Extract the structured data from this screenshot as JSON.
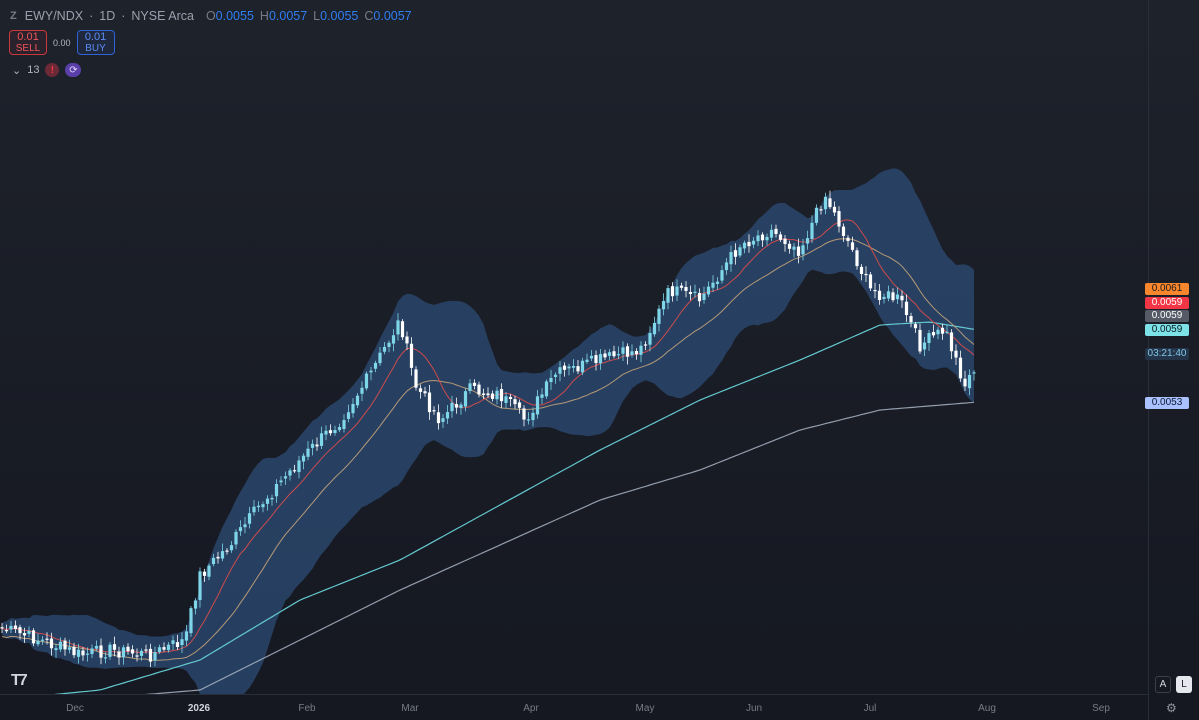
{
  "header": {
    "logo": "Z",
    "symbol": "EWY/NDX",
    "interval": "1D",
    "exchange": "NYSE Arca",
    "ohlc": [
      {
        "k": "O",
        "v": "0.0055"
      },
      {
        "k": "H",
        "v": "0.0057"
      },
      {
        "k": "L",
        "v": "0.0055"
      },
      {
        "k": "C",
        "v": "0.0057"
      }
    ]
  },
  "trade": {
    "sell_amount": "0.01",
    "sell_label": "SELL",
    "spread": "0.00",
    "buy_amount": "0.01",
    "buy_label": "BUY"
  },
  "indicators": {
    "count": "13",
    "warn": "!",
    "sync": "⟳"
  },
  "price_labels": [
    {
      "text": "0.0061",
      "bg": "#f7862d",
      "fg": "#1b1b1b"
    },
    {
      "text": "0.0059",
      "bg": "#f23645",
      "fg": "#ffffff"
    },
    {
      "text": "0.0059",
      "bg": "#555a66",
      "fg": "#ffffff"
    },
    {
      "text": "0.0059",
      "bg": "#7de2e8",
      "fg": "#0b1a1d"
    },
    {
      "text": "03:21:40",
      "bg": "#243449",
      "fg": "#7fc6e8"
    },
    {
      "text": "0.0053",
      "bg": "#a9c1ff",
      "fg": "#0d1730"
    }
  ],
  "x_axis": [
    "Dec",
    "2026",
    "Feb",
    "Mar",
    "Apr",
    "May",
    "Jun",
    "Jul",
    "Aug",
    "Sep"
  ],
  "scale_buttons": {
    "auto": "A",
    "log": "L"
  },
  "colors": {
    "band_fill": "#2b4a72",
    "up": "#7fd6e8",
    "down": "#ffffff",
    "ma_fast": "#e04b4b",
    "ma_mid": "#c7a37a",
    "ma_slow": "#64c8cf",
    "ma_long": "#a9b4c4"
  },
  "chart_data": {
    "type": "candlestick",
    "x_axis_labels": [
      "Dec",
      "2026",
      "Feb",
      "Mar",
      "Apr",
      "May",
      "Jun",
      "Jul",
      "Aug",
      "Sep"
    ],
    "y_unit": "ratio",
    "ohlc_close_sample": [
      0.0041,
      0.004,
      0.0039,
      0.0039,
      0.004,
      0.0044,
      0.0047,
      0.005,
      0.0052,
      0.0055,
      0.0053,
      0.0053,
      0.0054,
      0.0053,
      0.0055,
      0.0057,
      0.0059,
      0.0061,
      0.0061,
      0.0062,
      0.006,
      0.0059,
      0.0056,
      0.0055,
      0.0057
    ],
    "last_close": 0.0057,
    "open": 0.0055,
    "high": 0.0057,
    "low": 0.0055,
    "close": 0.0057,
    "lines": [
      "bollinger_upper",
      "bollinger_lower",
      "ma_fast",
      "ma_mid",
      "ma_slow",
      "ma_long"
    ]
  }
}
